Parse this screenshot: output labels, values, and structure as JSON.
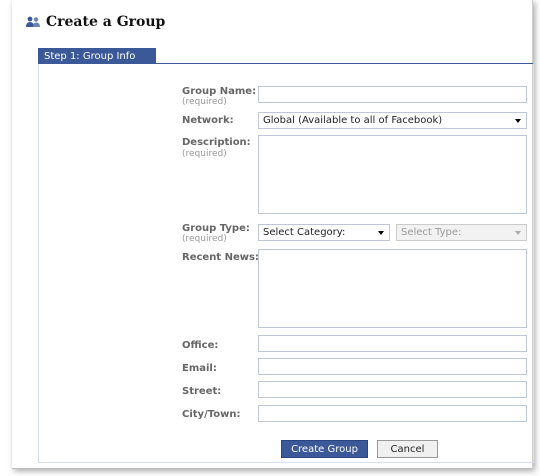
{
  "header": {
    "title": "Create a Group",
    "icon": "group-icon"
  },
  "tabs": [
    {
      "label": "Step 1: Group Info"
    }
  ],
  "form": {
    "group_name": {
      "label": "Group Name:",
      "hint": "(required)",
      "value": ""
    },
    "network": {
      "label": "Network:",
      "selected": "Global (Available to all of Facebook)"
    },
    "description": {
      "label": "Description:",
      "hint": "(required)",
      "value": ""
    },
    "group_type": {
      "label": "Group Type:",
      "hint": "(required)",
      "category": "Select Category:",
      "type": "Select Type:"
    },
    "recent_news": {
      "label": "Recent News:",
      "value": ""
    },
    "office": {
      "label": "Office:",
      "value": ""
    },
    "email": {
      "label": "Email:",
      "value": ""
    },
    "street": {
      "label": "Street:",
      "value": ""
    },
    "city": {
      "label": "City/Town:",
      "value": ""
    }
  },
  "actions": {
    "create": "Create Group",
    "cancel": "Cancel"
  },
  "colors": {
    "accent": "#3b5998",
    "border": "#bdc7d8"
  }
}
